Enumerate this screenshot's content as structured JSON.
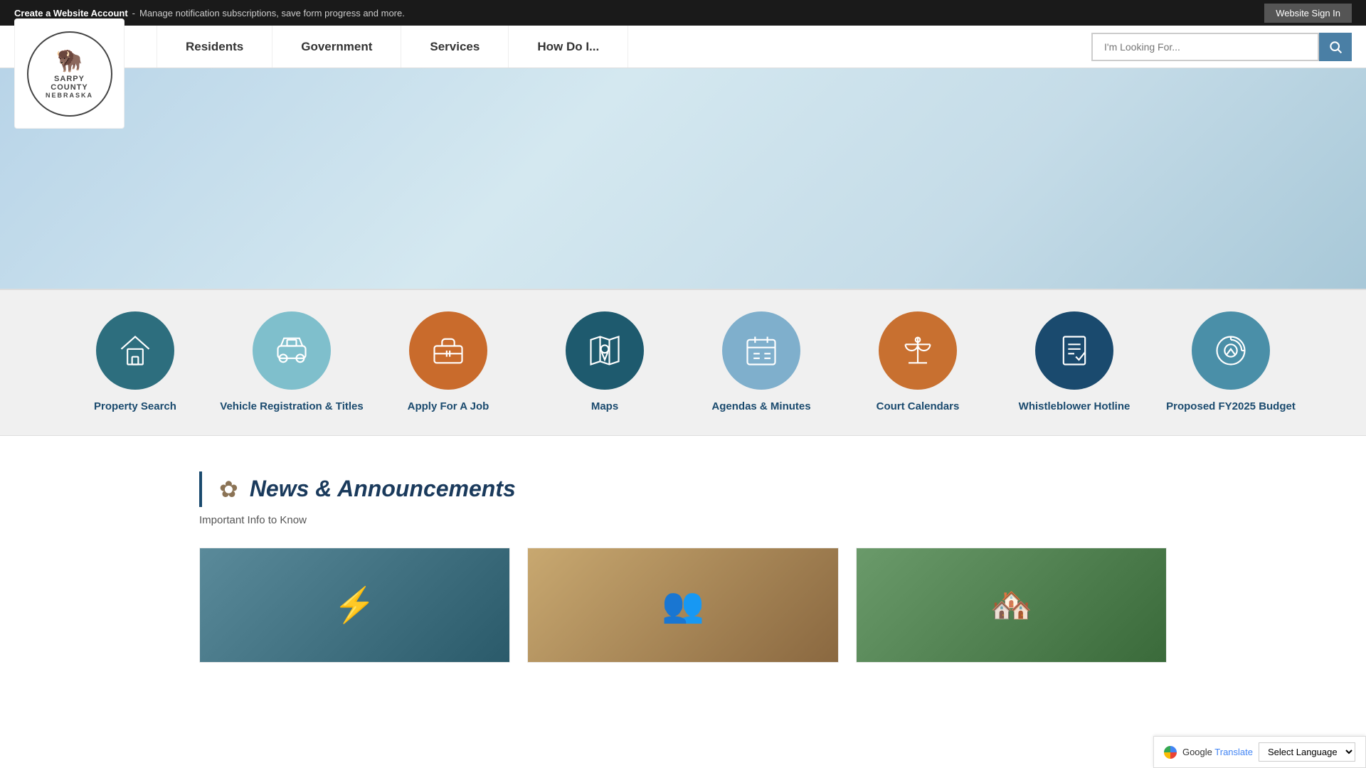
{
  "topBar": {
    "createAccount": "Create a Website Account",
    "separator": " - ",
    "description": "Manage notification subscriptions, save form progress and more.",
    "signInLabel": "Website Sign In"
  },
  "nav": {
    "links": [
      {
        "id": "residents",
        "label": "Residents"
      },
      {
        "id": "government",
        "label": "Government"
      },
      {
        "id": "services",
        "label": "Services"
      },
      {
        "id": "howdoi",
        "label": "How Do I..."
      }
    ],
    "searchPlaceholder": "I'm Looking For...",
    "logoAlt": "Sarpy County Nebraska"
  },
  "quickLinks": [
    {
      "id": "property-search",
      "label": "Property Search",
      "icon": "home",
      "colorClass": "ql-teal"
    },
    {
      "id": "vehicle-registration",
      "label": "Vehicle Registration & Titles",
      "icon": "car",
      "colorClass": "ql-light-teal"
    },
    {
      "id": "apply-for-job",
      "label": "Apply For A Job",
      "icon": "briefcase",
      "colorClass": "ql-orange"
    },
    {
      "id": "maps",
      "label": "Maps",
      "icon": "map",
      "colorClass": "ql-dark-teal"
    },
    {
      "id": "agendas-minutes",
      "label": "Agendas & Minutes",
      "icon": "calendar",
      "colorClass": "ql-light-blue"
    },
    {
      "id": "court-calendars",
      "label": "Court Calendars",
      "icon": "scales",
      "colorClass": "ql-orange2"
    },
    {
      "id": "whistleblower-hotline",
      "label": "Whistleblower Hotline",
      "icon": "checklist",
      "colorClass": "ql-dark-blue"
    },
    {
      "id": "fy2025-budget",
      "label": "Proposed FY2025 Budget",
      "icon": "money",
      "colorClass": "ql-blue-teal"
    }
  ],
  "news": {
    "sectionTitle": "News & Announcements",
    "subtitle": "Important Info to Know",
    "cards": [
      {
        "id": "news-1",
        "imgAlt": "Utility worker on pole",
        "imgType": "utility"
      },
      {
        "id": "news-2",
        "imgAlt": "People in meeting",
        "imgType": "people"
      },
      {
        "id": "news-3",
        "imgAlt": "Aerial view of neighborhood",
        "imgType": "aerial"
      }
    ]
  },
  "footer": {
    "googleLabel": "Google",
    "translateLabel": "Translate",
    "selectLanguageLabel": "Select Language"
  }
}
